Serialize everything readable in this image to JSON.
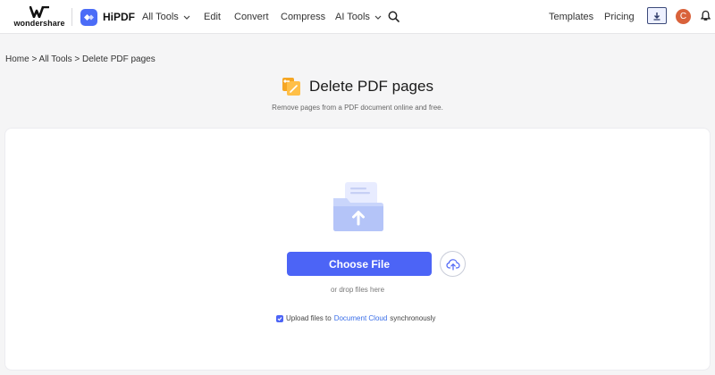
{
  "brand": {
    "wondershare_label": "wondershare",
    "product_name": "HiPDF",
    "accent_color": "#4c64f6"
  },
  "nav": {
    "all_tools": "All Tools",
    "edit": "Edit",
    "convert": "Convert",
    "compress": "Compress",
    "ai_tools": "AI Tools",
    "templates": "Templates",
    "pricing": "Pricing",
    "avatar_initial": "C"
  },
  "breadcrumb": {
    "home": "Home",
    "sep1": " > ",
    "all_tools": "All Tools",
    "sep2": " > ",
    "current": "Delete PDF pages"
  },
  "page": {
    "title": "Delete PDF pages",
    "subtitle": "Remove pages from a PDF document online and free."
  },
  "upload": {
    "choose_file_label": "Choose File",
    "drop_hint": "or drop files here",
    "sync_prefix": "Upload files to",
    "sync_link": "Document Cloud",
    "sync_suffix": "synchronously",
    "sync_checked": true
  },
  "icons": {
    "wondershare_logo": "wondershare-logo-icon",
    "hipdf_logo": "hipdf-logo-icon",
    "search": "search-icon",
    "download_app": "download-app-icon",
    "bell": "bell-icon",
    "tool": "delete-pages-tool-icon",
    "folder": "folder-upload-icon",
    "cloud_upload": "cloud-upload-icon"
  }
}
